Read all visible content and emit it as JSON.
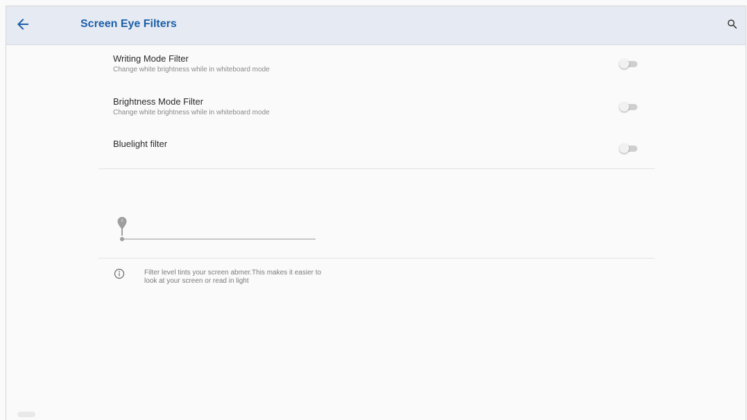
{
  "appbar": {
    "title": "Screen Eye Filters",
    "back_icon": "arrow-left-icon",
    "search_icon": "search-icon",
    "accent_color": "#1b5fa8"
  },
  "settings": [
    {
      "title": "Writing Mode Filter",
      "subtitle": "Change white brightness while in whiteboard mode",
      "enabled": false
    },
    {
      "title": "Brightness Mode Filter",
      "subtitle": "Change white brightness while in whiteboard mode",
      "enabled": false
    },
    {
      "title": "Bluelight filter",
      "enabled": false
    }
  ],
  "filter_level": {
    "value": 0
  },
  "info": {
    "icon": "info-icon",
    "text_line1": "Filter level tints your screen abmer.This makes it easier to",
    "text_line2": "look at your screen or read in light"
  }
}
